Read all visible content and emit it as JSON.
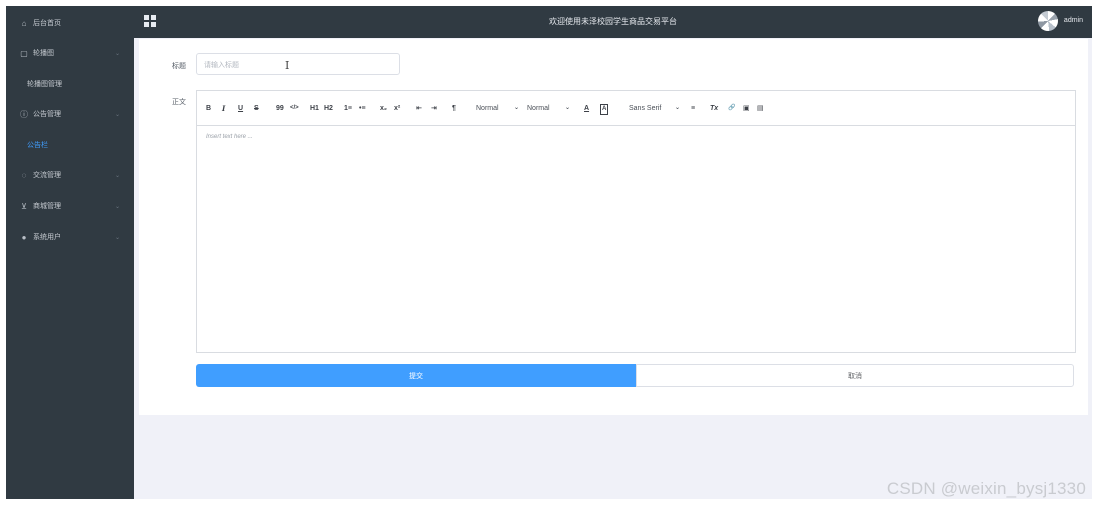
{
  "sidebar": {
    "items": [
      {
        "icon": "home-icon",
        "glyph": "⌂",
        "label": "后台首页",
        "has_arrow": false
      },
      {
        "icon": "image-icon",
        "glyph": "▢",
        "label": "轮播图",
        "has_arrow": true
      },
      {
        "sub": true,
        "label": "轮播图管理"
      },
      {
        "icon": "info-icon",
        "glyph": "ⓘ",
        "label": "公告管理",
        "has_arrow": true
      },
      {
        "sub": true,
        "active": true,
        "label": "公告栏"
      },
      {
        "icon": "chat-icon",
        "glyph": "◌",
        "label": "交流管理",
        "has_arrow": true
      },
      {
        "icon": "cart-icon",
        "glyph": "⊻",
        "label": "商城管理",
        "has_arrow": true
      },
      {
        "icon": "user-icon",
        "glyph": "●",
        "label": "系统用户",
        "has_arrow": true
      }
    ],
    "arrow_glyph": "⌄",
    "active_color": "#409eff"
  },
  "header": {
    "title": "欢迎使用未泽校园学生商品交易平台",
    "username": "admin",
    "menu_icon": "grid-icon",
    "avatar_icon": "avatar"
  },
  "form": {
    "title_label": "标题",
    "title_placeholder": "请输入标题",
    "title_value": "",
    "body_label": "正文",
    "editor_placeholder": "Insert text here ...",
    "toolbar": {
      "buttons": [
        {
          "name": "bold-icon",
          "glyph": "B"
        },
        {
          "name": "italic-icon",
          "glyph": "I"
        },
        {
          "name": "underline-icon",
          "glyph": "U"
        },
        {
          "name": "strike-icon",
          "glyph": "S"
        },
        {
          "name": "quote-icon",
          "glyph": "99"
        },
        {
          "name": "code-icon",
          "glyph": "</>"
        },
        {
          "name": "header1-icon",
          "glyph": "H1"
        },
        {
          "name": "header2-icon",
          "glyph": "H2"
        },
        {
          "name": "ordered-list-icon",
          "glyph": "1≡"
        },
        {
          "name": "bullet-list-icon",
          "glyph": "•≡"
        },
        {
          "name": "subscript-icon",
          "glyph": "x₂"
        },
        {
          "name": "superscript-icon",
          "glyph": "x²"
        },
        {
          "name": "outdent-icon",
          "glyph": "⇤"
        },
        {
          "name": "indent-icon",
          "glyph": "⇥"
        },
        {
          "name": "direction-icon",
          "glyph": "¶"
        }
      ],
      "size_select": "Normal",
      "header_select": "Normal",
      "color_icon_glyph": "A",
      "background_icon_glyph": "A",
      "font_select": "Sans Serif",
      "align_glyph": "≡",
      "clean_glyph": "Tx",
      "link_glyph": "🔗",
      "image_glyph": "▣",
      "video_glyph": "▤",
      "caret": "⌄"
    },
    "submit_label": "提交",
    "cancel_label": "取消"
  },
  "watermark": "CSDN @weixin_bysj1330"
}
